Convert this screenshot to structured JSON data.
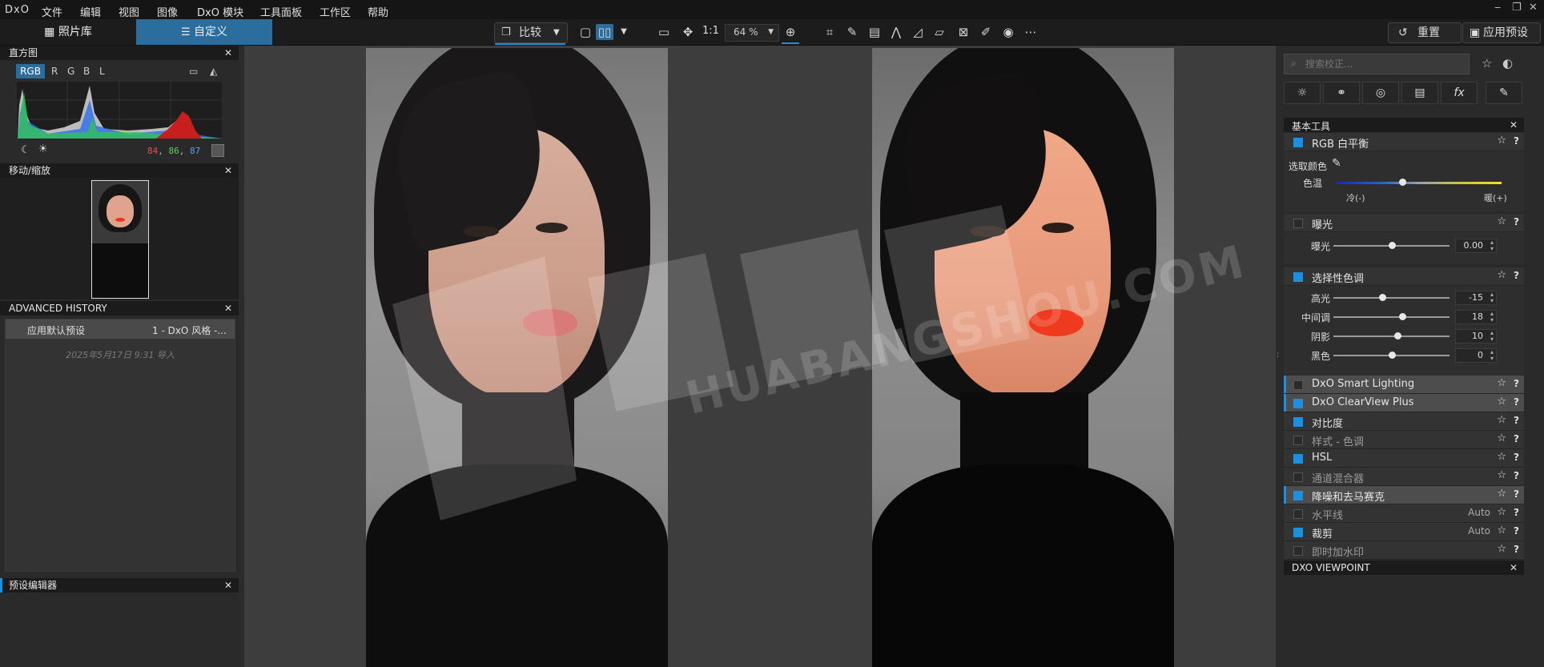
{
  "app": {
    "logo": "DxO"
  },
  "menu": [
    "文件",
    "编辑",
    "视图",
    "图像",
    "DxO 模块",
    "工具面板",
    "工作区",
    "帮助"
  ],
  "window_controls": [
    "‒",
    "❐",
    "✕"
  ],
  "tabs": {
    "library": "照片库",
    "customize": "自定义"
  },
  "toolbar": {
    "compare_label": "比较",
    "one_to_one": "1:1",
    "zoom_value": "64 %",
    "reset_label": "重置",
    "apply_preset_label": "应用预设"
  },
  "left": {
    "histogram": {
      "title": "直方图",
      "channels": [
        "RGB",
        "R",
        "G",
        "B",
        "L"
      ],
      "readout": {
        "r": "84",
        "g": "86",
        "b": "87",
        "sep": ","
      }
    },
    "move_zoom": {
      "title": "移动/缩放"
    },
    "history": {
      "title": "ADVANCED HISTORY",
      "item_label": "应用默认预设",
      "item_value": "1 - DxO 风格 -...",
      "timestamp": "2025年5月17日 9:31 导入"
    },
    "preset_editor": {
      "title": "预设编辑器"
    }
  },
  "right": {
    "search_placeholder": "搜索校正...",
    "section_title": "基本工具",
    "white_balance": {
      "title": "RGB 白平衡",
      "pick_label": "选取颜色",
      "temp_label": "色温",
      "cold": "冷(-)",
      "warm": "暖(+)"
    },
    "exposure": {
      "title": "曝光",
      "slider_label": "曝光",
      "value": "0.00",
      "level": 0.5
    },
    "selective_tone": {
      "title": "选择性色调",
      "sliders": [
        {
          "label": "高光",
          "value": "-15",
          "level": 0.42
        },
        {
          "label": "中间调",
          "value": "18",
          "level": 0.59
        },
        {
          "label": "阴影",
          "value": "10",
          "level": 0.55
        },
        {
          "label": "黑色",
          "value": "0",
          "level": 0.5
        }
      ]
    },
    "modules": [
      {
        "label": "DxO Smart Lighting",
        "on": false,
        "dim": false,
        "highlight": true,
        "auto": ""
      },
      {
        "label": "DxO ClearView Plus",
        "on": true,
        "dim": false,
        "highlight": true,
        "auto": ""
      },
      {
        "label": "对比度",
        "on": true,
        "dim": false,
        "highlight": false,
        "auto": ""
      },
      {
        "label": "样式 - 色调",
        "on": false,
        "dim": true,
        "highlight": false,
        "auto": ""
      },
      {
        "label": "HSL",
        "on": true,
        "dim": false,
        "highlight": false,
        "auto": ""
      },
      {
        "label": "通道混合器",
        "on": false,
        "dim": true,
        "highlight": false,
        "auto": ""
      },
      {
        "label": "降噪和去马赛克",
        "on": true,
        "dim": false,
        "highlight": true,
        "auto": ""
      },
      {
        "label": "水平线",
        "on": false,
        "dim": true,
        "highlight": false,
        "auto": "Auto"
      },
      {
        "label": "裁剪",
        "on": true,
        "dim": false,
        "highlight": false,
        "auto": "Auto"
      },
      {
        "label": "即时加水印",
        "on": false,
        "dim": true,
        "highlight": false,
        "auto": ""
      }
    ],
    "viewpoint_title": "DXO VIEWPOINT"
  },
  "watermark": {
    "text": "HUABANGSHOU.COM"
  },
  "colors": {
    "accent": "#1d8fe0",
    "tab_active": "#2b6e9e",
    "lips_before": "#d87a78",
    "lips_after": "#f03a1f"
  }
}
